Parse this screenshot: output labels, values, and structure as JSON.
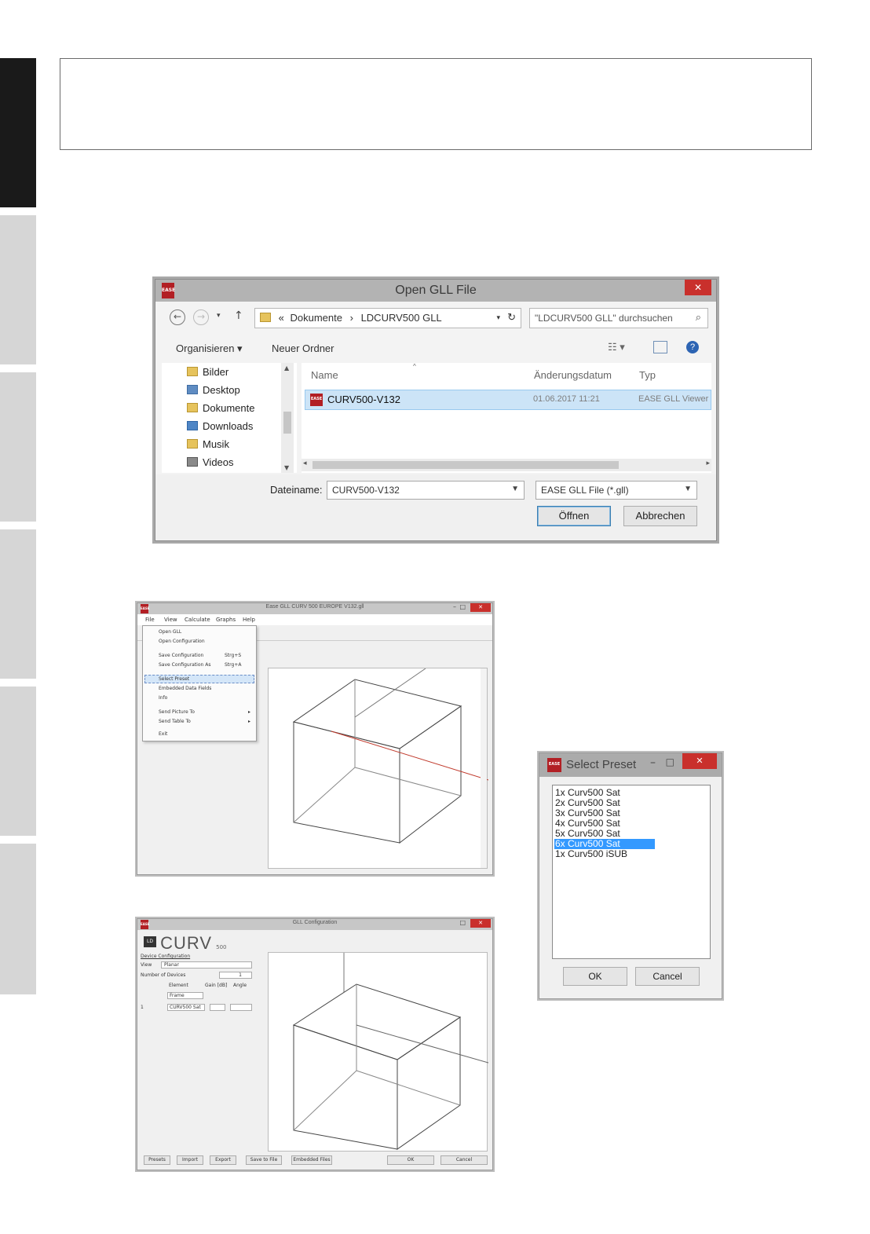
{
  "open_dialog": {
    "title": "Open GLL File",
    "app_icon_text": "EASE",
    "close_glyph": "✕",
    "path_sep1": "«",
    "path_seg1": "Dokumente",
    "path_sep2": "›",
    "path_seg2": "LDCURV500 GLL",
    "search_placeholder": "\"LDCURV500 GLL\" durchsuchen",
    "organize_label": "Organisieren ▾",
    "new_folder_label": "Neuer Ordner",
    "nav_items": [
      "Bilder",
      "Desktop",
      "Dokumente",
      "Downloads",
      "Musik",
      "Videos"
    ],
    "columns": [
      "Name",
      "Änderungsdatum",
      "Typ"
    ],
    "file_name": "CURV500-V132",
    "file_date": "01.06.2017 11:21",
    "file_type": "EASE GLL Viewer",
    "filename_label": "Dateiname:",
    "filename_value": "CURV500-V132",
    "filetype_value": "EASE GLL File (*.gll)",
    "open_button": "Öffnen",
    "cancel_button": "Abbrechen"
  },
  "viewer_window": {
    "title": "Ease GLL CURV 500 EUROPE V132.gll",
    "menu": [
      "File",
      "View",
      "Calculate",
      "Graphs",
      "Help"
    ],
    "file_menu": [
      "Open GLL",
      "Open Configuration",
      "Save Configuration",
      "Save Configuration As",
      "Select Preset",
      "Embedded Data Fields",
      "Info",
      "Send Picture To",
      "Send Table To",
      "Exit"
    ],
    "shortcuts": [
      "Strg+S",
      "Strg+A"
    ]
  },
  "config_window": {
    "title": "GLL Configuration",
    "logo_text": "CURV",
    "logo_sub": "500",
    "section_label": "Device Configuration",
    "view_label": "View",
    "view_value": "Planar",
    "devices_label": "Number of Devices",
    "devices_value": "1",
    "col_labels": [
      "Element",
      "Gain [dB]",
      "Angle"
    ],
    "element_value": "Frame",
    "row_value": "CURV500 Sat",
    "buttons": [
      "Presets",
      "Import",
      "Export",
      "Save to File",
      "Embedded Files",
      "OK",
      "Cancel"
    ]
  },
  "preset_window": {
    "title": "Select Preset",
    "items": [
      "1x Curv500 Sat",
      "2x Curv500 Sat",
      "3x Curv500 Sat",
      "4x Curv500 Sat",
      "5x Curv500 Sat",
      "6x Curv500 Sat",
      "1x Curv500 iSUB"
    ],
    "selected_index": 5,
    "ok_button": "OK",
    "cancel_button": "Cancel"
  }
}
